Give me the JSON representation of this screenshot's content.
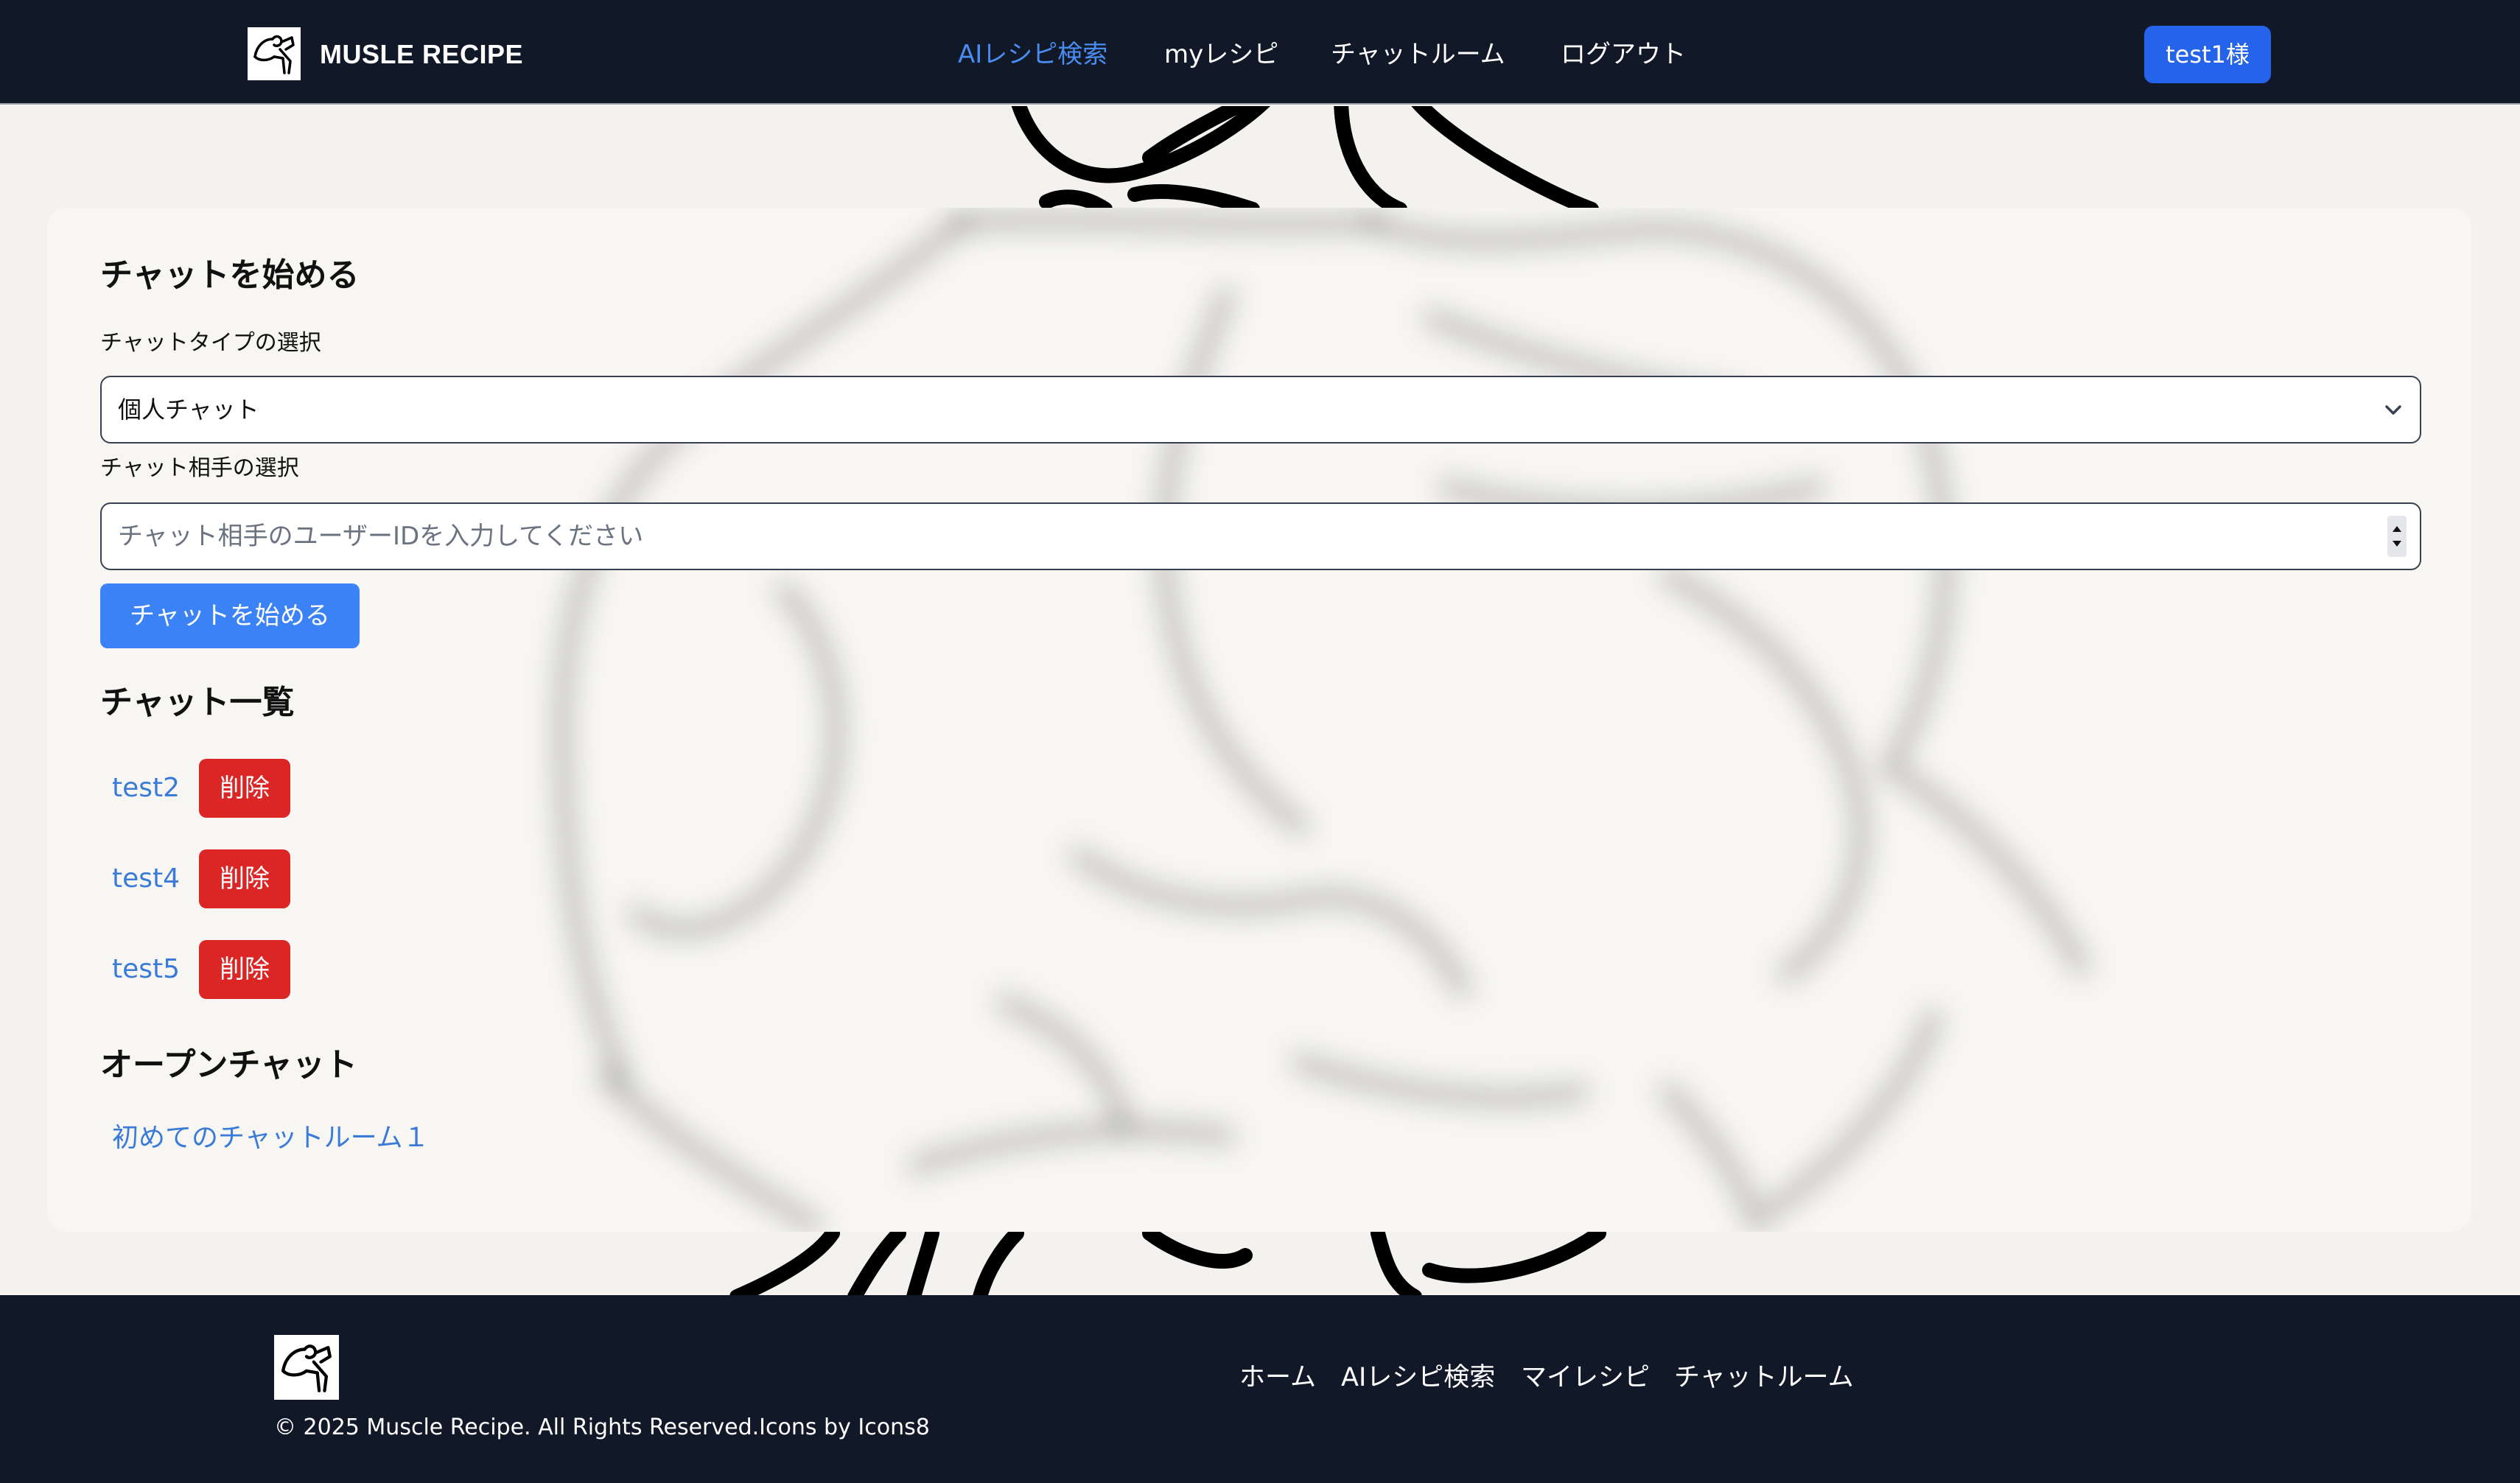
{
  "header": {
    "brand": "MUSLE RECIPE",
    "nav": [
      {
        "label": "AIレシピ検索",
        "active": true
      },
      {
        "label": "myレシピ",
        "active": false
      },
      {
        "label": "チャットルーム",
        "active": false
      },
      {
        "label": "ログアウト",
        "active": false
      }
    ],
    "user_button": "test1様"
  },
  "main": {
    "start_chat_heading": "チャットを始める",
    "chat_type_label": "チャットタイプの選択",
    "chat_type_selected": "個人チャット",
    "partner_label": "チャット相手の選択",
    "partner_placeholder": "チャット相手のユーザーIDを入力してください",
    "start_button": "チャットを始める",
    "chat_list_heading": "チャット一覧",
    "chats": [
      {
        "name": "test2",
        "delete_label": "削除"
      },
      {
        "name": "test4",
        "delete_label": "削除"
      },
      {
        "name": "test5",
        "delete_label": "削除"
      }
    ],
    "open_chat_heading": "オープンチャット",
    "open_chats": [
      "初めてのチャットルーム１"
    ]
  },
  "footer": {
    "copyright": "© 2025 Muscle Recipe. All Rights Reserved.Icons by Icons8",
    "links": [
      "ホーム",
      "AIレシピ検索",
      "マイレシピ",
      "チャットルーム"
    ]
  },
  "colors": {
    "header_bg": "#111827",
    "accent": "#2563eb",
    "link": "#3b7bd8",
    "active_nav": "#4a8cf0",
    "danger": "#dc2626"
  },
  "icons": [
    "muscle-logo-icon",
    "chevron-down-icon",
    "spinner-arrows-icon"
  ]
}
